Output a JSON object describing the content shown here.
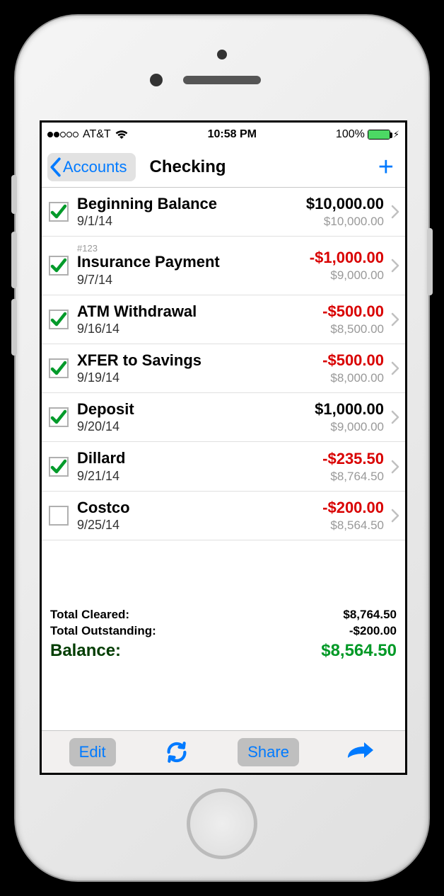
{
  "statusbar": {
    "carrier": "AT&T",
    "time": "10:58 PM",
    "battery_pct": "100%"
  },
  "navbar": {
    "back_label": "Accounts",
    "title": "Checking"
  },
  "transactions": [
    {
      "ref": "",
      "title": "Beginning Balance",
      "date": "9/1/14",
      "amount": "$10,000.00",
      "negative": false,
      "running": "$10,000.00",
      "checked": true
    },
    {
      "ref": "#123",
      "title": "Insurance Payment",
      "date": "9/7/14",
      "amount": "-$1,000.00",
      "negative": true,
      "running": "$9,000.00",
      "checked": true
    },
    {
      "ref": "",
      "title": "ATM Withdrawal",
      "date": "9/16/14",
      "amount": "-$500.00",
      "negative": true,
      "running": "$8,500.00",
      "checked": true
    },
    {
      "ref": "",
      "title": "XFER to Savings",
      "date": "9/19/14",
      "amount": "-$500.00",
      "negative": true,
      "running": "$8,000.00",
      "checked": true
    },
    {
      "ref": "",
      "title": "Deposit",
      "date": "9/20/14",
      "amount": "$1,000.00",
      "negative": false,
      "running": "$9,000.00",
      "checked": true
    },
    {
      "ref": "",
      "title": "Dillard",
      "date": "9/21/14",
      "amount": "-$235.50",
      "negative": true,
      "running": "$8,764.50",
      "checked": true
    },
    {
      "ref": "",
      "title": "Costco",
      "date": "9/25/14",
      "amount": "-$200.00",
      "negative": true,
      "running": "$8,564.50",
      "checked": false
    }
  ],
  "summary": {
    "cleared_label": "Total Cleared:",
    "cleared_value": "$8,764.50",
    "outstanding_label": "Total Outstanding:",
    "outstanding_value": "-$200.00",
    "balance_label": "Balance:",
    "balance_value": "$8,564.50"
  },
  "toolbar": {
    "edit_label": "Edit",
    "share_label": "Share"
  }
}
